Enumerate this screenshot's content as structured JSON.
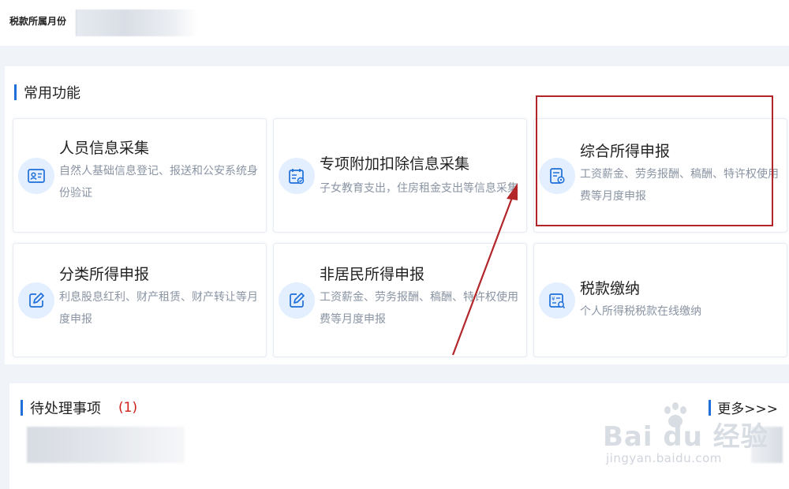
{
  "header": {
    "period_label": "税款所属月份",
    "period_value": ""
  },
  "common": {
    "title": "常用功能",
    "cards": [
      {
        "title": "人员信息采集",
        "desc": "自然人基础信息登记、报送和公安系统身份验证",
        "icon": "id-card-icon"
      },
      {
        "title": "专项附加扣除信息采集",
        "desc": "子女教育支出，住房租金支出等信息采集",
        "icon": "tax-calendar-icon"
      },
      {
        "title": "综合所得申报",
        "desc": "工资薪金、劳务报酬、稿酬、特许权使用费等月度申报",
        "icon": "report-document-icon"
      },
      {
        "title": "分类所得申报",
        "desc": "利息股息红利、财产租赁、财产转让等月度申报",
        "icon": "edit-icon"
      },
      {
        "title": "非居民所得申报",
        "desc": "工资薪金、劳务报酬、稿酬、特许权使用费等月度申报",
        "icon": "edit-icon"
      },
      {
        "title": "税款缴纳",
        "desc": "个人所得税税款在线缴纳",
        "icon": "tax-payment-icon"
      }
    ]
  },
  "pending": {
    "title": "待处理事项",
    "count": "(1)",
    "more": "更多>>>"
  },
  "watermark": {
    "main": "Bai du 经验",
    "sub": "jingyan.baidu.com"
  },
  "colors": {
    "accent": "#1e6fd9",
    "highlight": "#b2262a",
    "icon_bg": "#e3efff",
    "badge": "#d0211c"
  }
}
